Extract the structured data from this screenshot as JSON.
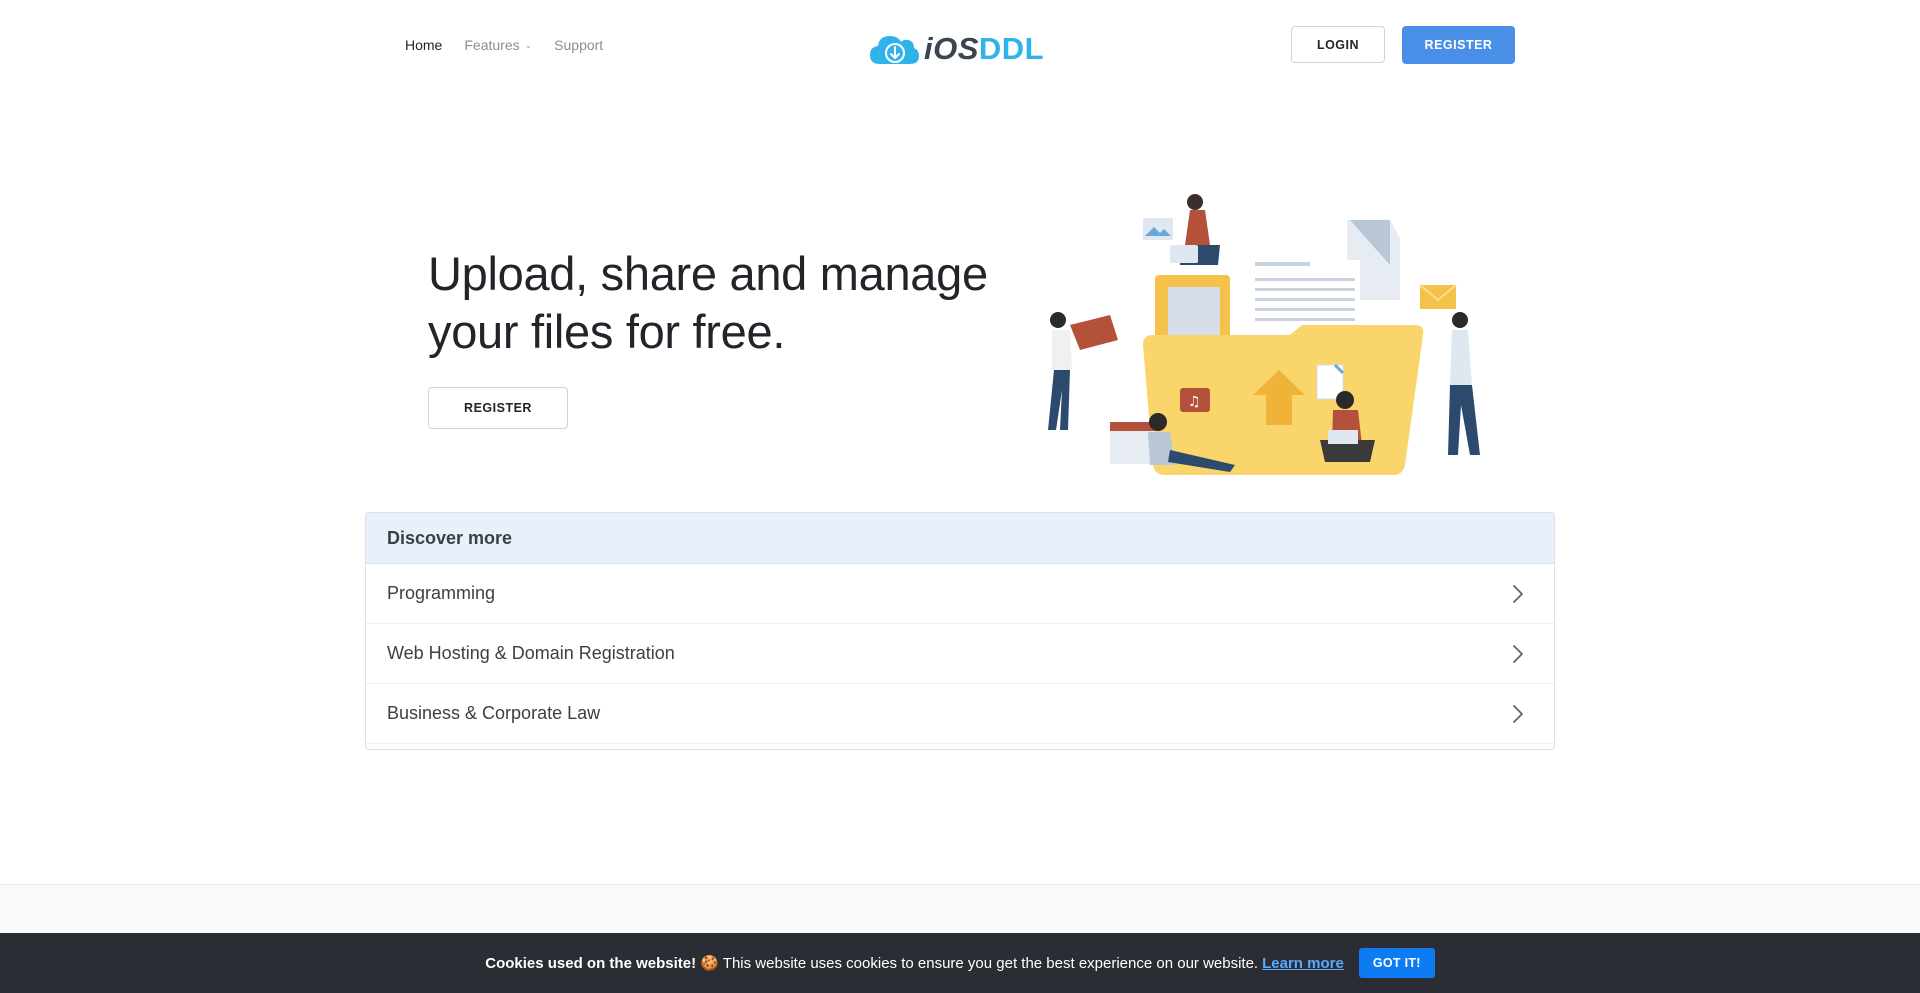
{
  "nav": {
    "home": "Home",
    "features": "Features",
    "support": "Support"
  },
  "logo": {
    "part1": "iOS",
    "part2": "DDL"
  },
  "header": {
    "login": "LOGIN",
    "register": "REGISTER"
  },
  "hero": {
    "title_line1": "Upload, share and manage",
    "title_line2": "your files for free.",
    "register": "REGISTER"
  },
  "discover": {
    "title": "Discover more",
    "items": [
      {
        "label": "Programming"
      },
      {
        "label": "Web Hosting & Domain Registration"
      },
      {
        "label": "Business & Corporate Law"
      }
    ]
  },
  "cookie": {
    "title": "Cookies used on the website!",
    "emoji": "🍪",
    "message": "This website uses cookies to ensure you get the best experience on our website.",
    "learn_more": "Learn more",
    "accept": "GOT IT!"
  },
  "colors": {
    "primary": "#4a8fe7",
    "logo_ddl": "#2fb4ea",
    "cookie_bg": "#2a2d33",
    "cookie_button": "#0d7bf2"
  }
}
